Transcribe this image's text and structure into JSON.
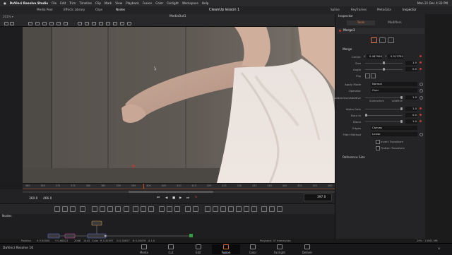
{
  "menubar": {
    "apple": "",
    "app_name": "DaVinci Resolve Studio",
    "items": [
      "File",
      "Edit",
      "Trim",
      "Timeline",
      "Clip",
      "Mark",
      "View",
      "Playback",
      "Fusion",
      "Color",
      "Fairlight",
      "Workspace",
      "Help"
    ],
    "clock": "Mon 21 Dec 4:33 PM"
  },
  "topbar": {
    "left_buttons": [
      "Media Pool",
      "Effects Library",
      "Clips",
      "Nodes"
    ],
    "project_title": "CleanUp lesson 1",
    "right_buttons": [
      "Spline",
      "Keyframes",
      "Metadata",
      "Inspector"
    ]
  },
  "viewer": {
    "zoom": "201% ▾",
    "title": "MediaOut1"
  },
  "ruler": {
    "ticks": [
      "360",
      "365",
      "370",
      "375",
      "380",
      "385",
      "390",
      "395",
      "400",
      "405",
      "410",
      "415",
      "420",
      "425",
      "430",
      "435",
      "440",
      "445",
      "450",
      "455",
      "460"
    ]
  },
  "transport": {
    "start_tc": "360.0",
    "end_tc": "466.0",
    "current_frame": "397.0"
  },
  "nodes": {
    "label": "Nodes"
  },
  "status": {
    "position_label": "Position",
    "position_x": "X 0.50000",
    "position_y": "Y 0.66823",
    "px_a": "2068",
    "px_b": "1443",
    "color_label": "Color",
    "r": "R 0.32597",
    "g": "G 0.30627",
    "b": "B 0.28476",
    "a": "A 1.0",
    "playback": "Playback: 37 frames/sec",
    "memory": "29% · 13561 MB"
  },
  "pages": [
    {
      "label": "Media",
      "icon": "media-icon"
    },
    {
      "label": "Cut",
      "icon": "cut-icon"
    },
    {
      "label": "Edit",
      "icon": "edit-icon"
    },
    {
      "label": "Fusion",
      "icon": "fusion-icon"
    },
    {
      "label": "Color",
      "icon": "color-icon"
    },
    {
      "label": "Fairlight",
      "icon": "fairlight-icon"
    },
    {
      "label": "Deliver",
      "icon": "deliver-icon"
    }
  ],
  "active_page": "Fusion",
  "brand": "DaVinci Resolve 16",
  "inspector": {
    "title": "Inspector",
    "tabs": [
      "Tools",
      "Modifiers"
    ],
    "active_tab": "Tools",
    "node_name": "Merge3",
    "group": "Merge",
    "center_label": "Center",
    "center_x": "0.487990",
    "center_y": "0.513761",
    "size_label": "Size",
    "size_value": "1.0",
    "size_fraction": 0.5,
    "angle_label": "Angle",
    "angle_value": "0.0",
    "angle_fraction": 0.5,
    "flip_label": "Flip",
    "apply_mode_label": "Apply Mode",
    "apply_mode_value": "Normal",
    "operator_label": "Operator",
    "operator_value": "Over",
    "subadd_label": "Subtractive/Additive",
    "subadd_value": "1.0",
    "subadd_fraction": 1.0,
    "subtractive_word": "Subtractive",
    "additive_word": "Additive",
    "alpha_gain_label": "Alpha Gain",
    "alpha_gain_value": "1.0",
    "alpha_gain_fraction": 1.0,
    "burn_in_label": "Burn In",
    "burn_in_value": "0.0",
    "burn_in_fraction": 0.0,
    "blend_label": "Blend",
    "blend_value": "1.0",
    "blend_fraction": 1.0,
    "edges_label": "Edges",
    "edges_value": "Canvas",
    "filter_label": "Filter Method",
    "filter_value": "Linear",
    "invert_label": "Invert Transform",
    "flatten_label": "Flatten Transform",
    "refsize_label": "Reference Size"
  },
  "colors": {
    "accent": "#e0622a",
    "keyframe": "#c0392b"
  }
}
